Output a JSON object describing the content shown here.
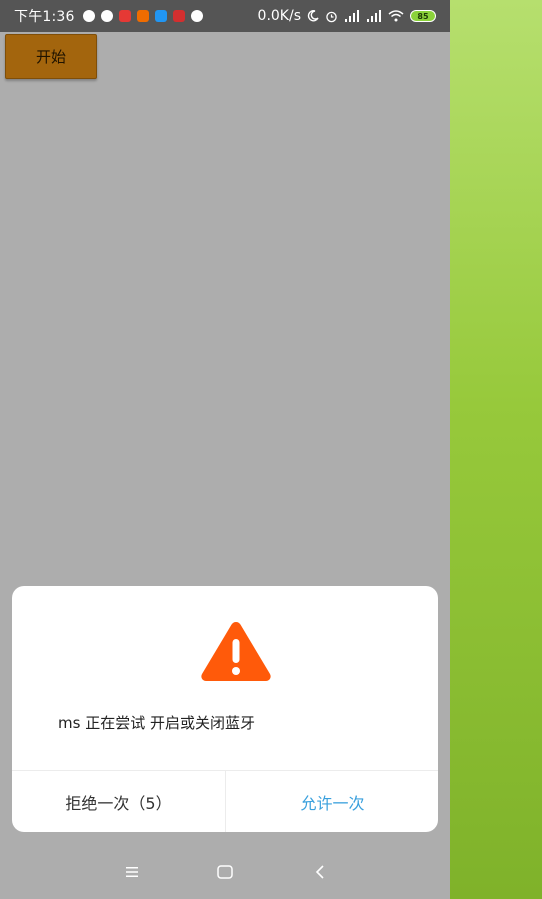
{
  "status_bar": {
    "time": "下午1:36",
    "net_speed": "0.0K/s",
    "battery": "85",
    "notification_icons": [
      {
        "name": "shield-icon",
        "color": "#ffffff"
      },
      {
        "name": "app-icon",
        "color": "#ffffff"
      },
      {
        "name": "red-app-icon",
        "color": "#e53935"
      },
      {
        "name": "orange-app-icon",
        "color": "#ef6c00"
      },
      {
        "name": "blue-app-icon",
        "color": "#2196f3"
      },
      {
        "name": "red-white-app-icon",
        "color": "#d32f2f"
      },
      {
        "name": "circle-app-icon",
        "color": "#ffffff"
      }
    ]
  },
  "app": {
    "start_button_label": "开始"
  },
  "dialog": {
    "message": "ms 正在尝试 开启或关闭蓝牙",
    "deny_label": "拒绝一次（5）",
    "allow_label": "允许一次",
    "icon": "warning-icon",
    "colors": {
      "warning": "#ff5a0a",
      "allow": "#3aa0dd"
    }
  },
  "nav_bar": {
    "icons": [
      "menu-icon",
      "home-icon",
      "back-icon"
    ]
  }
}
